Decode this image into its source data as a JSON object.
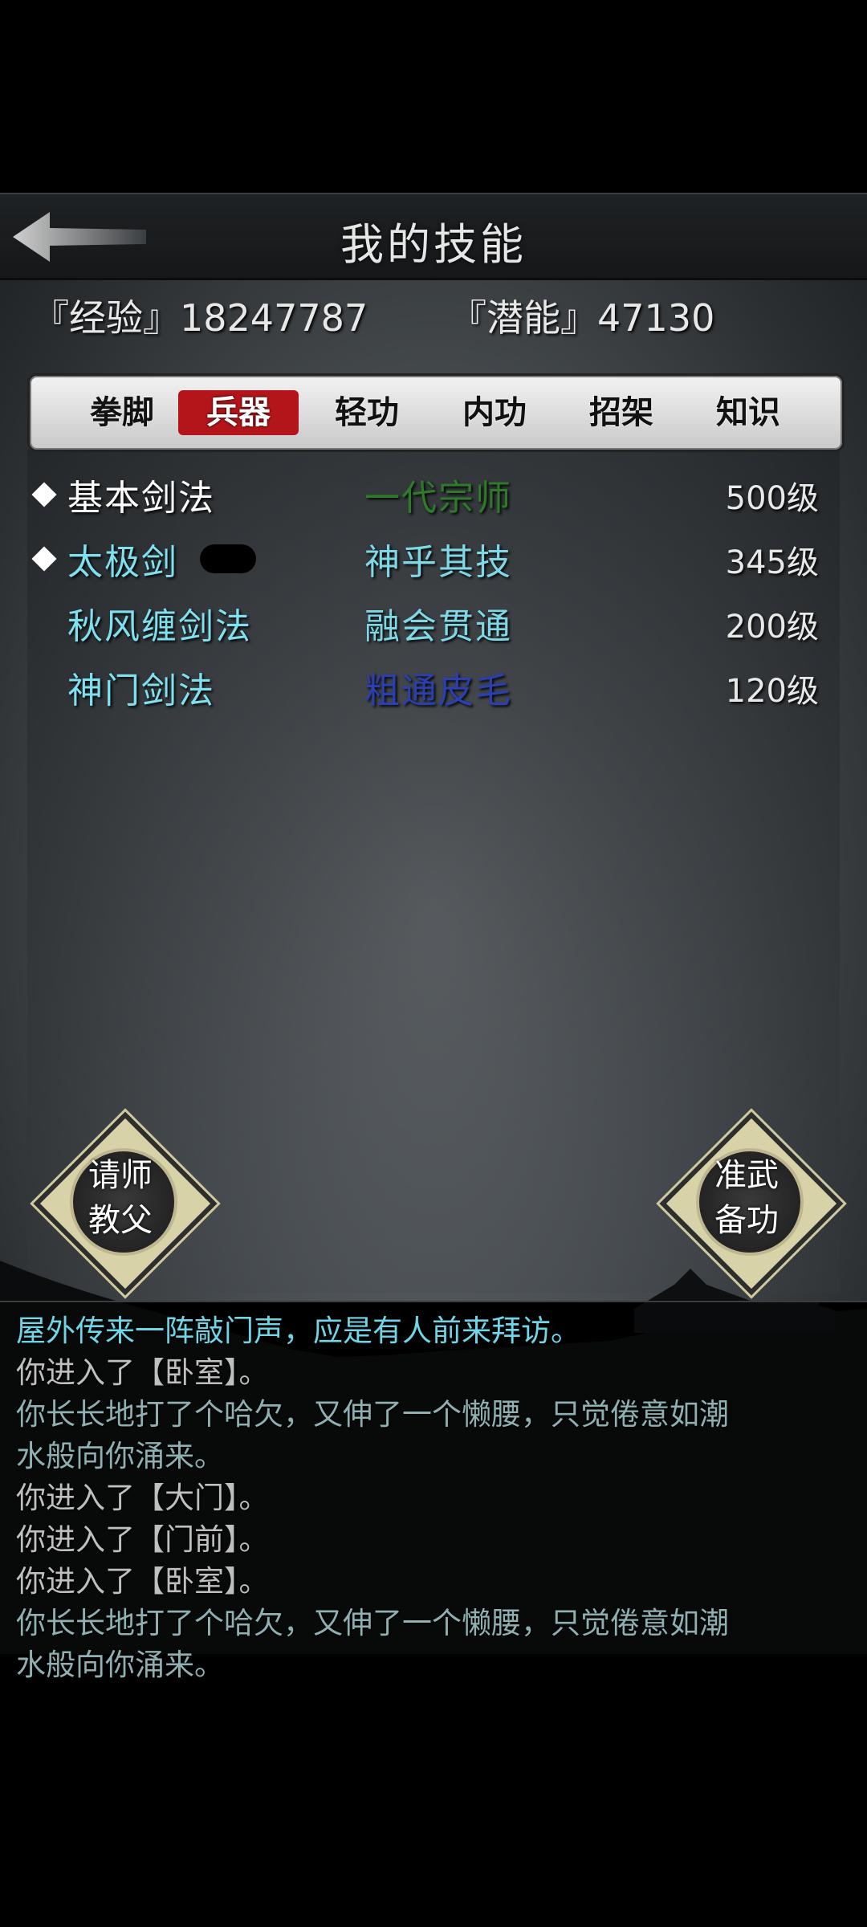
{
  "header": {
    "title": "我的技能"
  },
  "stats": {
    "exp_label": "『经验』18247787",
    "pot_label": "『潜能』47130"
  },
  "tabs": [
    {
      "label": "拳脚",
      "active": false
    },
    {
      "label": "兵器",
      "active": true
    },
    {
      "label": "轻功",
      "active": false
    },
    {
      "label": "内功",
      "active": false
    },
    {
      "label": "招架",
      "active": false
    },
    {
      "label": "知识",
      "active": false
    }
  ],
  "skills": [
    {
      "name": "基本剑法",
      "rank": "一代宗师",
      "level": "500级",
      "name_color": "#ffffff",
      "rank_color": "#2f7a2a",
      "marked": true
    },
    {
      "name": "太极剑",
      "rank": "神乎其技",
      "level": "345级",
      "name_color": "#7fe0f0",
      "rank_color": "#7fd8e6",
      "marked": true
    },
    {
      "name": "秋风缠剑法",
      "rank": "融会贯通",
      "level": "200级",
      "name_color": "#7fe0f0",
      "rank_color": "#7fd8e6",
      "marked": false
    },
    {
      "name": "神门剑法",
      "rank": "粗通皮毛",
      "level": "120级",
      "name_color": "#7fe0f0",
      "rank_color": "#2a3fb0",
      "marked": false
    }
  ],
  "buttons": {
    "left": {
      "line1": "请师",
      "line2": "教父"
    },
    "right": {
      "line1": "准武",
      "line2": "备功"
    }
  },
  "log": [
    {
      "text": "屋外传来一阵敲门声，应是有人前来拜访。",
      "color": "#6fd6e8"
    },
    {
      "text": "你进入了【卧室】。",
      "color": "#bfbfbf"
    },
    {
      "text": "你长长地打了个哈欠，又伸了一个懒腰，只觉倦意如潮",
      "color": "#8fb0b3"
    },
    {
      "text": "水般向你涌来。",
      "color": "#8fb0b3"
    },
    {
      "text": "你进入了【大门】。",
      "color": "#bfbfbf"
    },
    {
      "text": "你进入了【门前】。",
      "color": "#bfbfbf"
    },
    {
      "text": "你进入了【卧室】。",
      "color": "#bfbfbf"
    },
    {
      "text": "你长长地打了个哈欠，又伸了一个懒腰，只觉倦意如潮",
      "color": "#8fb0b3"
    },
    {
      "text": "水般向你涌来。",
      "color": "#8fb0b3"
    }
  ]
}
